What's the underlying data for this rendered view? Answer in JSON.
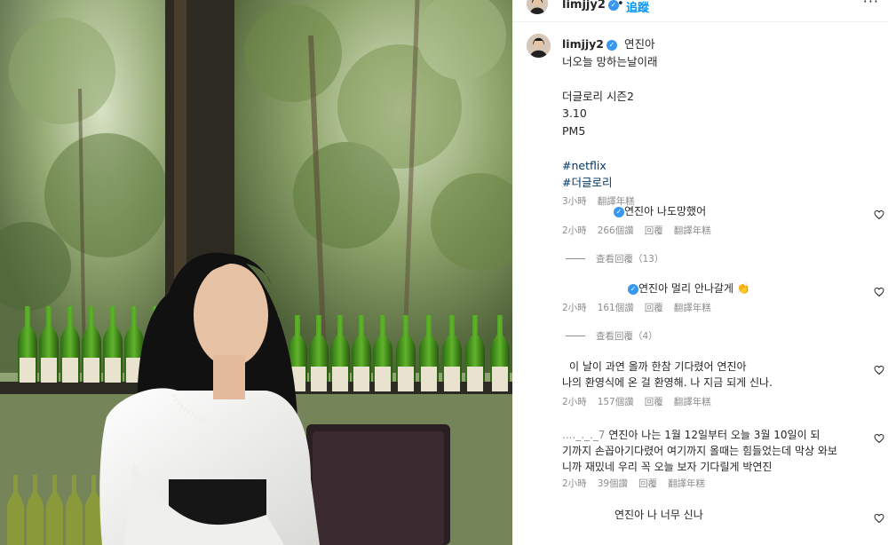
{
  "post": {
    "username": "limjjy2",
    "follow_label": "追蹤",
    "separator": "•",
    "more_label": "···"
  },
  "caption": {
    "username": "limjjy2",
    "lines": [
      "연진아",
      "너오늘 망하는날이래",
      "",
      "더글로리 시즌2",
      "3.10",
      "PM5",
      "",
      "#netflix",
      "#더글로리"
    ],
    "time": "3小時",
    "translate": "翻譯年糕"
  },
  "comments": [
    {
      "text": "연진아 나도망했어",
      "time": "2小時",
      "likes": "266個讚",
      "reply": "回覆",
      "translate": "翻譯年糕",
      "view_replies": "查看回覆（13）"
    },
    {
      "text": "연진아 멀리 안나갈게 👏",
      "time": "2小時",
      "likes": "161個讚",
      "reply": "回覆",
      "translate": "翻譯年糕",
      "view_replies": "查看回覆（4）"
    },
    {
      "line1": "이 날이 과연 올까 한참 기다렸어 연진아",
      "line2": "나의 환영식에 온 걸 환영해. 나 지금 되게 신나.",
      "time": "2小時",
      "likes": "157個讚",
      "reply": "回覆",
      "translate": "翻譯年糕"
    },
    {
      "prefix": "...._._._7",
      "line1": "연진아 나는 1월 12일부터 오늘 3월 10일이 되",
      "line2": "기까지 손꼽아기다렸어 여기까지 올때는 힘들었는데 막상 와보",
      "line3": "니까 재밌네 우리 꼭 오늘 보자 기다릴게 박연진",
      "time": "2小時",
      "likes": "39個讚",
      "reply": "回覆",
      "translate": "翻譯年糕"
    },
    {
      "text": "연진아 나 너무 신나"
    }
  ],
  "colors": {
    "link": "#00376b",
    "follow": "#0095f6",
    "verified": "#3897f0",
    "meta": "#8e8e8e"
  },
  "icons": [
    "verified-badge-icon",
    "heart-icon",
    "more-icon"
  ]
}
